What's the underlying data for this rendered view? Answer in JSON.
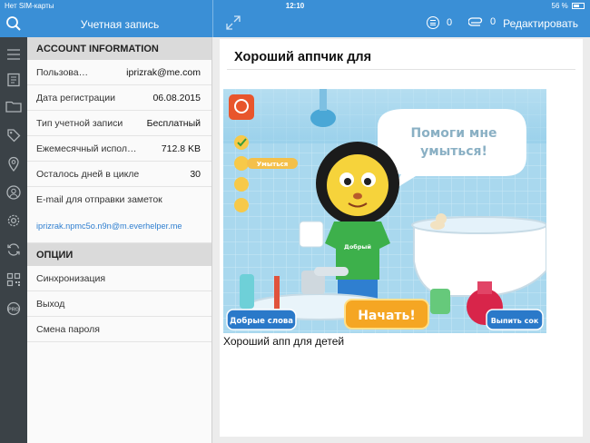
{
  "status_bar": {
    "carrier": "Нет SIM-карты",
    "time": "12:10",
    "battery": "56 %"
  },
  "header": {
    "account_title": "Учетная запись",
    "notes_count": "0",
    "attachments_count": "0",
    "edit_label": "Редактировать"
  },
  "account": {
    "section_title": "ACCOUNT INFORMATION",
    "rows": [
      {
        "label": "Пользова…",
        "value": "iprizrak@me.com"
      },
      {
        "label": "Дата регистрации",
        "value": "06.08.2015"
      },
      {
        "label": "Тип учетной записи",
        "value": "Бесплатный"
      },
      {
        "label": "Ежемесячный испол…",
        "value": "712.8 KB"
      },
      {
        "label": "Осталось дней в цикле",
        "value": "30"
      }
    ],
    "email_label": "E-mail для отправки заметок",
    "email_value": "iprizrak.npmc5o.n9n@m.everhelper.me"
  },
  "options": {
    "section_title": "ОПЦИИ",
    "items": [
      "Синхронизация",
      "Выход",
      "Смена пароля"
    ]
  },
  "note": {
    "title": "Хороший аппчик для",
    "caption": "Хороший апп для детей",
    "image": {
      "bubble_text_1": "Помоги мне",
      "bubble_text_2": "умыться!",
      "btn_left": "Добрые слова",
      "btn_start": "Начать!",
      "btn_right": "Выпить сок",
      "tag_wash": "Умыться",
      "shirt_text": "Добрый"
    }
  },
  "colors": {
    "accent": "#3a8fd6",
    "rail": "#3b4247",
    "link": "#2f7fd0"
  }
}
